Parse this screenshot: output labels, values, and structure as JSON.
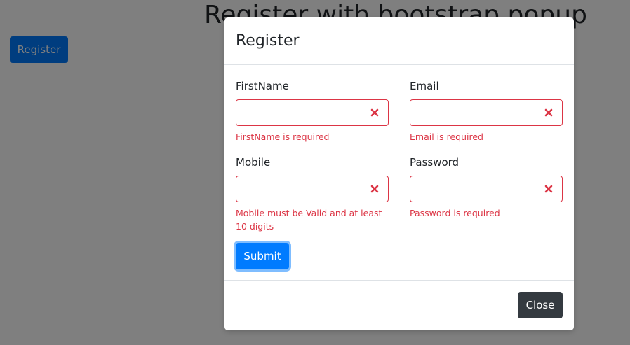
{
  "page": {
    "heading": "Register with bootstrap popup",
    "open_button_label": "Register"
  },
  "modal": {
    "title": "Register",
    "fields": {
      "firstname": {
        "label": "FirstName",
        "value": "",
        "error": "FirstName is required"
      },
      "email": {
        "label": "Email",
        "value": "",
        "error": "Email is required"
      },
      "mobile": {
        "label": "Mobile",
        "value": "",
        "error": "Mobile must be Valid and at least 10 digits"
      },
      "password": {
        "label": "Password",
        "value": "",
        "error": "Password is required"
      }
    },
    "submit_label": "Submit",
    "close_label": "Close"
  },
  "colors": {
    "primary": "#007bff",
    "danger": "#dc3545",
    "dark": "#343a40",
    "backdrop": "rgba(0,0,0,0.5)"
  },
  "icons": {
    "field_error": "error-x-icon"
  }
}
